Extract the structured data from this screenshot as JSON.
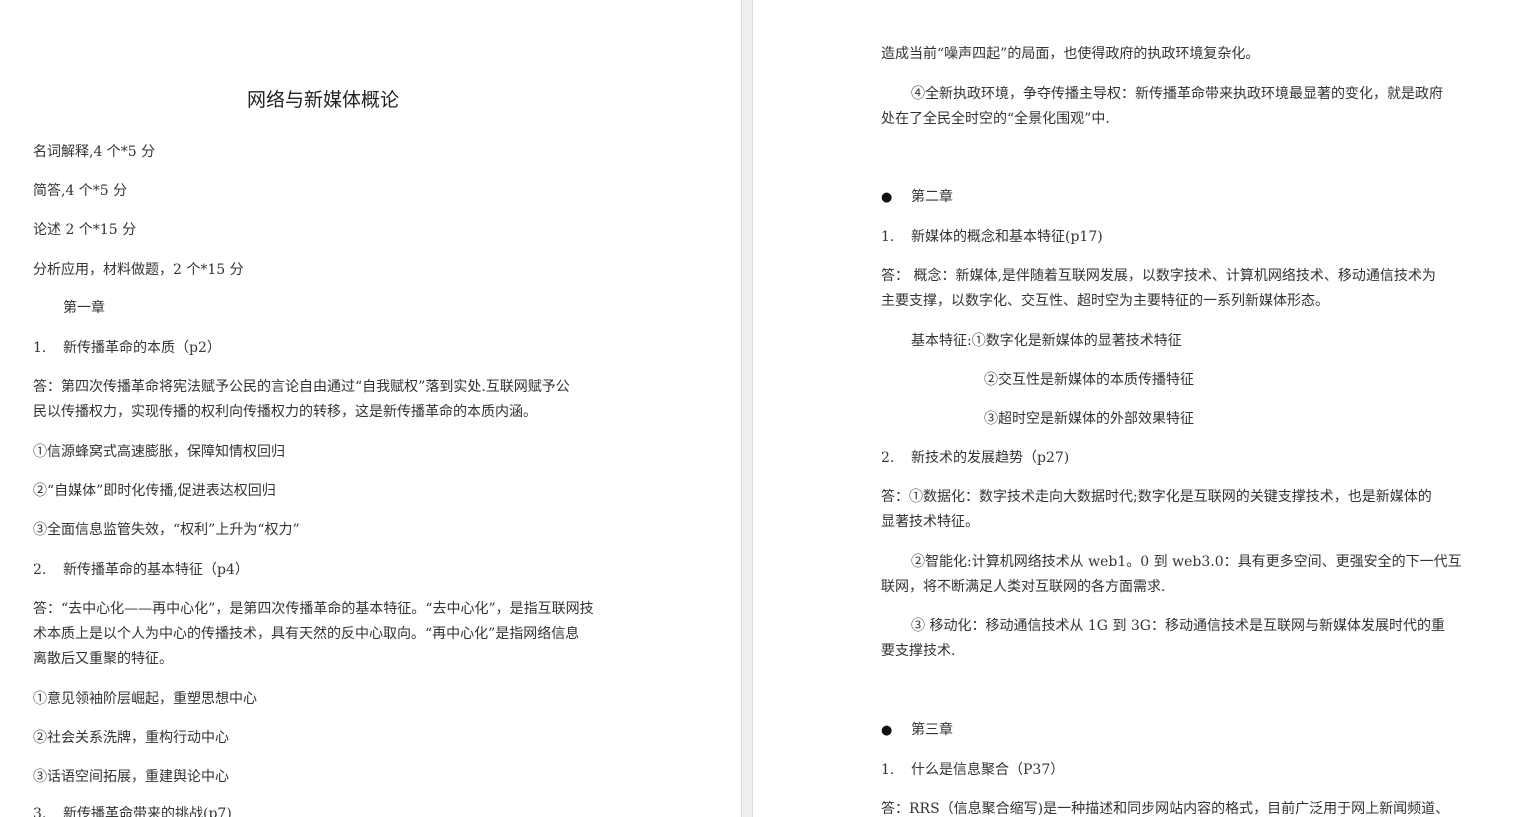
{
  "left": {
    "title": "网络与新媒体概论",
    "exam_items": [
      "名词解释,4 个*5 分",
      "简答,4 个*5 分",
      "论述 2 个*15 分",
      "分析应用，材料做题，2 个*15 分"
    ],
    "chapter1": "第一章",
    "q1": {
      "num": "1.",
      "text": "新传播革命的本质（p2）",
      "answer": [
        "答：第四次传播革命将宪法赋予公民的言论自由通过“自我赋权”落到实处.互联网赋予公",
        "民以传播权力，实现传播的权利向传播权力的转移，这是新传播革命的本质内涵。"
      ],
      "points": [
        "①信源蜂窝式高速膨胀，保障知情权回归",
        "②“自媒体”即时化传播,促进表达权回归",
        "③全面信息监管失效，“权利”上升为“权力”"
      ]
    },
    "q2": {
      "num": "2.",
      "text": "新传播革命的基本特征（p4）",
      "answer": [
        "答：“去中心化——再中心化”，是第四次传播革命的基本特征。“去中心化”，是指互联网技",
        "术本质上是以个人为中心的传播技术，具有天然的反中心取向。“再中心化”是指网络信息",
        "离散后又重聚的特征。"
      ],
      "points": [
        "①意见领袖阶层崛起，重塑思想中心",
        "②社会关系洗牌，重构行动中心",
        "③话语空间拓展，重建舆论中心"
      ]
    },
    "q3": {
      "num": "3.",
      "text": "新传播革命带来的挑战(p7)"
    }
  },
  "right": {
    "cont_line": "造成当前“噪声四起”的局面，也使得政府的执政环境复杂化。",
    "point4": [
      "④全新执政环境，争夺传播主导权：新传播革命带来执政环境最显著的变化，就是政府",
      "处在了全民全时空的“全景化围观”中."
    ],
    "bullet": "●",
    "chapter2": "第二章",
    "q1": {
      "num": "1.",
      "text": "新媒体的概念和基本特征(p17)",
      "answer": [
        "答：  概念：新媒体,是伴随着互联网发展，以数字技术、计算机网络技术、移动通信技术为",
        "主要支撑，以数字化、交互性、超时空为主要特征的一系列新媒体形态。"
      ],
      "features": [
        "基本特征:①数字化是新媒体的显著技术特征",
        "②交互性是新媒体的本质传播特征",
        "③超时空是新媒体的外部效果特征"
      ]
    },
    "q2": {
      "num": "2.",
      "text": "新技术的发展趋势（p27)",
      "answer": [
        "答：①数据化：数字技术走向大数据时代;数字化是互联网的关键支撑技术，也是新媒体的",
        "显著技术特征。"
      ],
      "p2": [
        "②智能化:计算机网络技术从 web1。0 到 web3.0：具有更多空间、更强安全的下一代互",
        "联网，将不断满足人类对互联网的各方面需求."
      ],
      "p3": [
        "③  移动化：移动通信技术从 1G 到 3G：移动通信技术是互联网与新媒体发展时代的重",
        "要支撑技术."
      ]
    },
    "chapter3": "第三章",
    "q3": {
      "num": "1.",
      "text": "什么是信息聚合（P37）",
      "answer": "答：RRS（信息聚合缩写)是一种描述和同步网站内容的格式，目前广泛用于网上新闻频道、"
    }
  }
}
